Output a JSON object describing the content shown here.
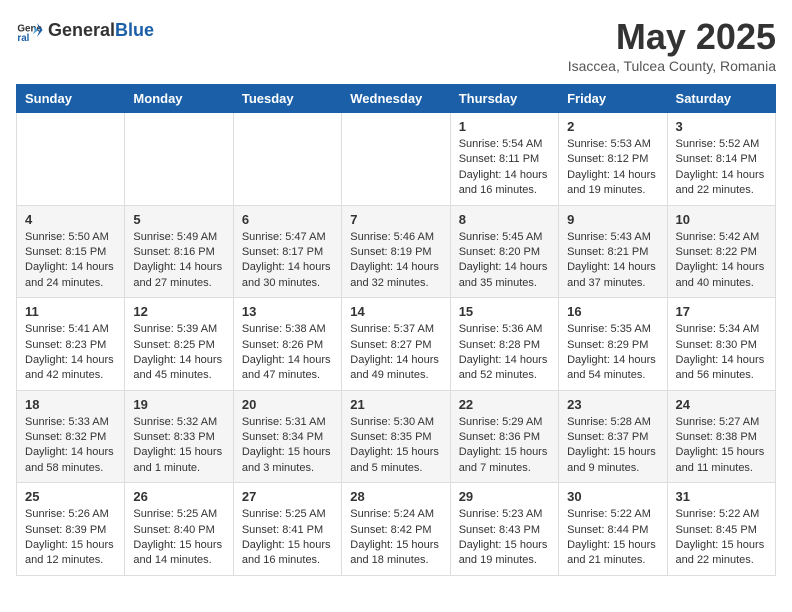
{
  "logo": {
    "general": "General",
    "blue": "Blue"
  },
  "header": {
    "month": "May 2025",
    "location": "Isaccea, Tulcea County, Romania"
  },
  "days_of_week": [
    "Sunday",
    "Monday",
    "Tuesday",
    "Wednesday",
    "Thursday",
    "Friday",
    "Saturday"
  ],
  "weeks": [
    [
      null,
      null,
      null,
      null,
      {
        "day": 1,
        "sunrise": "5:54 AM",
        "sunset": "8:11 PM",
        "daylight": "14 hours and 16 minutes."
      },
      {
        "day": 2,
        "sunrise": "5:53 AM",
        "sunset": "8:12 PM",
        "daylight": "14 hours and 19 minutes."
      },
      {
        "day": 3,
        "sunrise": "5:52 AM",
        "sunset": "8:14 PM",
        "daylight": "14 hours and 22 minutes."
      }
    ],
    [
      {
        "day": 4,
        "sunrise": "5:50 AM",
        "sunset": "8:15 PM",
        "daylight": "14 hours and 24 minutes."
      },
      {
        "day": 5,
        "sunrise": "5:49 AM",
        "sunset": "8:16 PM",
        "daylight": "14 hours and 27 minutes."
      },
      {
        "day": 6,
        "sunrise": "5:47 AM",
        "sunset": "8:17 PM",
        "daylight": "14 hours and 30 minutes."
      },
      {
        "day": 7,
        "sunrise": "5:46 AM",
        "sunset": "8:19 PM",
        "daylight": "14 hours and 32 minutes."
      },
      {
        "day": 8,
        "sunrise": "5:45 AM",
        "sunset": "8:20 PM",
        "daylight": "14 hours and 35 minutes."
      },
      {
        "day": 9,
        "sunrise": "5:43 AM",
        "sunset": "8:21 PM",
        "daylight": "14 hours and 37 minutes."
      },
      {
        "day": 10,
        "sunrise": "5:42 AM",
        "sunset": "8:22 PM",
        "daylight": "14 hours and 40 minutes."
      }
    ],
    [
      {
        "day": 11,
        "sunrise": "5:41 AM",
        "sunset": "8:23 PM",
        "daylight": "14 hours and 42 minutes."
      },
      {
        "day": 12,
        "sunrise": "5:39 AM",
        "sunset": "8:25 PM",
        "daylight": "14 hours and 45 minutes."
      },
      {
        "day": 13,
        "sunrise": "5:38 AM",
        "sunset": "8:26 PM",
        "daylight": "14 hours and 47 minutes."
      },
      {
        "day": 14,
        "sunrise": "5:37 AM",
        "sunset": "8:27 PM",
        "daylight": "14 hours and 49 minutes."
      },
      {
        "day": 15,
        "sunrise": "5:36 AM",
        "sunset": "8:28 PM",
        "daylight": "14 hours and 52 minutes."
      },
      {
        "day": 16,
        "sunrise": "5:35 AM",
        "sunset": "8:29 PM",
        "daylight": "14 hours and 54 minutes."
      },
      {
        "day": 17,
        "sunrise": "5:34 AM",
        "sunset": "8:30 PM",
        "daylight": "14 hours and 56 minutes."
      }
    ],
    [
      {
        "day": 18,
        "sunrise": "5:33 AM",
        "sunset": "8:32 PM",
        "daylight": "14 hours and 58 minutes."
      },
      {
        "day": 19,
        "sunrise": "5:32 AM",
        "sunset": "8:33 PM",
        "daylight": "15 hours and 1 minute."
      },
      {
        "day": 20,
        "sunrise": "5:31 AM",
        "sunset": "8:34 PM",
        "daylight": "15 hours and 3 minutes."
      },
      {
        "day": 21,
        "sunrise": "5:30 AM",
        "sunset": "8:35 PM",
        "daylight": "15 hours and 5 minutes."
      },
      {
        "day": 22,
        "sunrise": "5:29 AM",
        "sunset": "8:36 PM",
        "daylight": "15 hours and 7 minutes."
      },
      {
        "day": 23,
        "sunrise": "5:28 AM",
        "sunset": "8:37 PM",
        "daylight": "15 hours and 9 minutes."
      },
      {
        "day": 24,
        "sunrise": "5:27 AM",
        "sunset": "8:38 PM",
        "daylight": "15 hours and 11 minutes."
      }
    ],
    [
      {
        "day": 25,
        "sunrise": "5:26 AM",
        "sunset": "8:39 PM",
        "daylight": "15 hours and 12 minutes."
      },
      {
        "day": 26,
        "sunrise": "5:25 AM",
        "sunset": "8:40 PM",
        "daylight": "15 hours and 14 minutes."
      },
      {
        "day": 27,
        "sunrise": "5:25 AM",
        "sunset": "8:41 PM",
        "daylight": "15 hours and 16 minutes."
      },
      {
        "day": 28,
        "sunrise": "5:24 AM",
        "sunset": "8:42 PM",
        "daylight": "15 hours and 18 minutes."
      },
      {
        "day": 29,
        "sunrise": "5:23 AM",
        "sunset": "8:43 PM",
        "daylight": "15 hours and 19 minutes."
      },
      {
        "day": 30,
        "sunrise": "5:22 AM",
        "sunset": "8:44 PM",
        "daylight": "15 hours and 21 minutes."
      },
      {
        "day": 31,
        "sunrise": "5:22 AM",
        "sunset": "8:45 PM",
        "daylight": "15 hours and 22 minutes."
      }
    ]
  ]
}
